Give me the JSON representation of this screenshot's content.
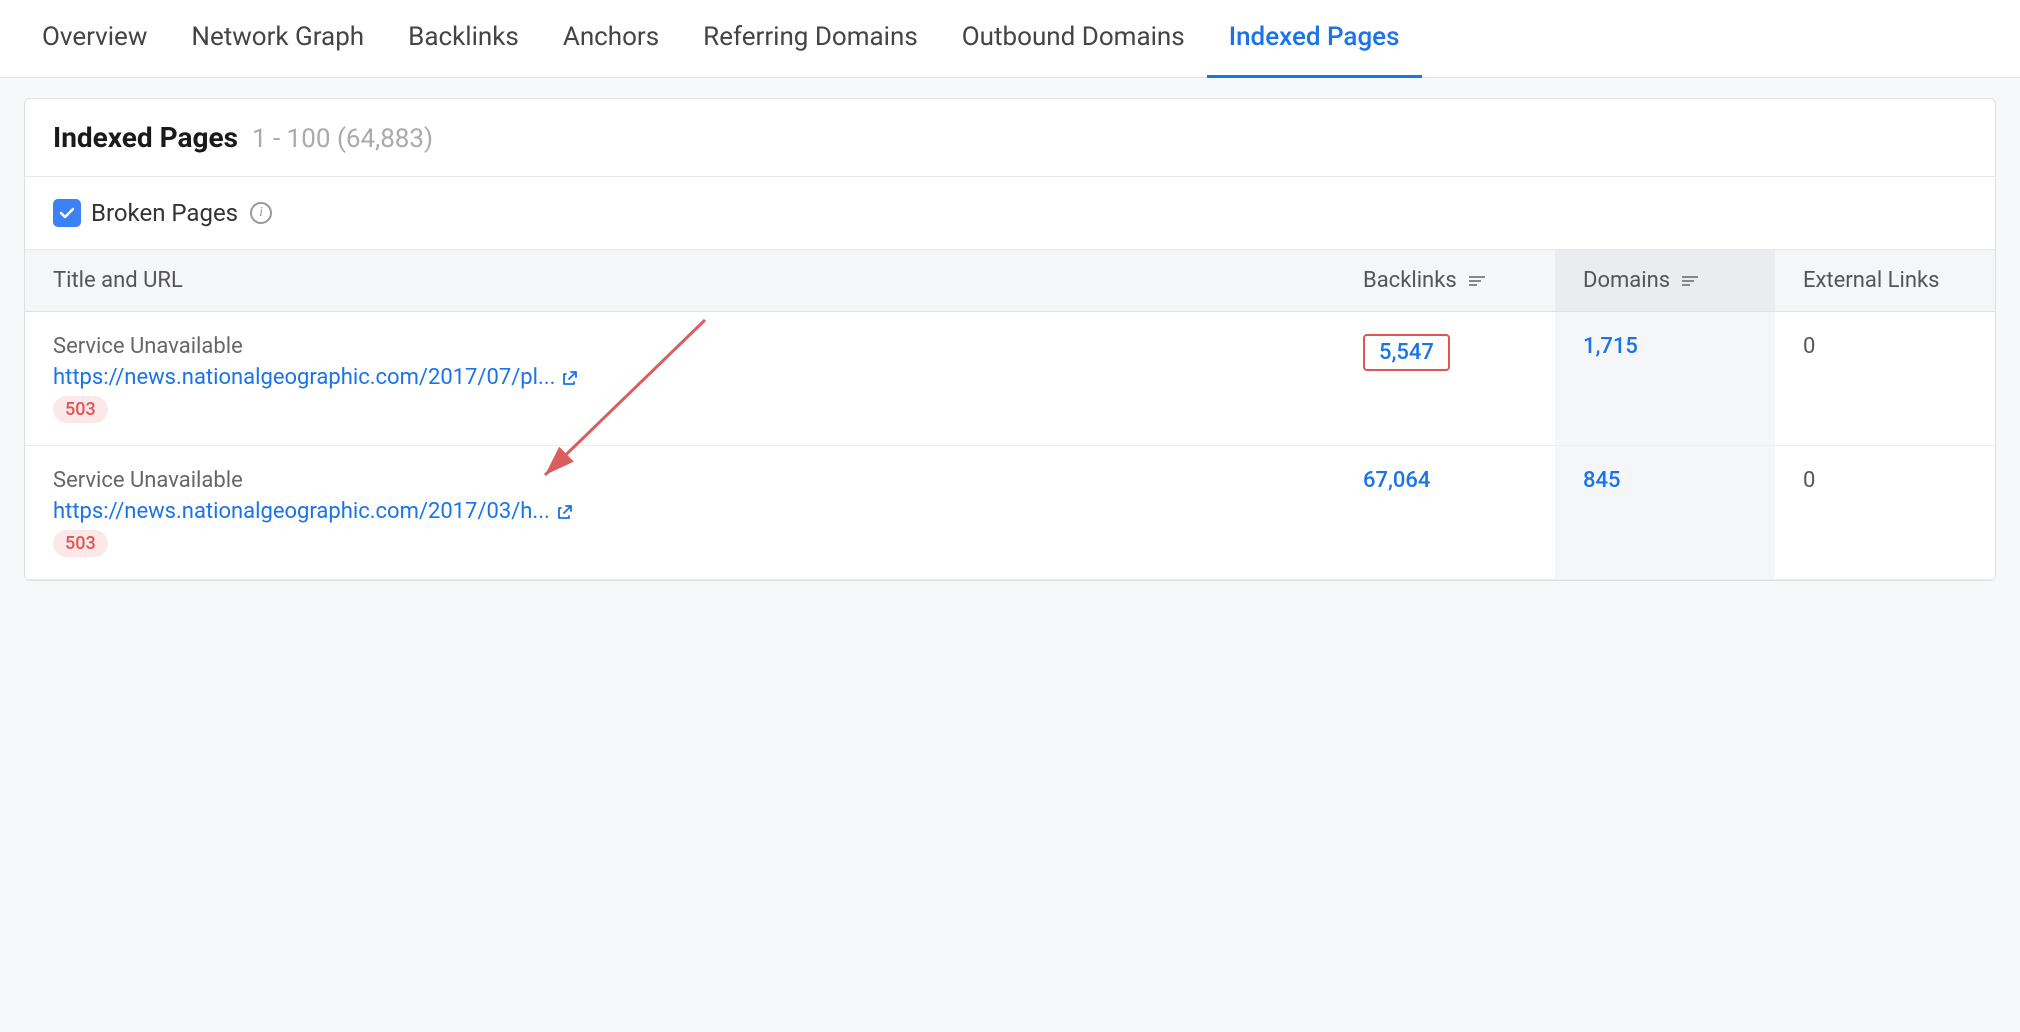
{
  "nav": {
    "items": [
      {
        "id": "overview",
        "label": "Overview",
        "active": false
      },
      {
        "id": "network-graph",
        "label": "Network Graph",
        "active": false
      },
      {
        "id": "backlinks",
        "label": "Backlinks",
        "active": false
      },
      {
        "id": "anchors",
        "label": "Anchors",
        "active": false
      },
      {
        "id": "referring-domains",
        "label": "Referring Domains",
        "active": false
      },
      {
        "id": "outbound-domains",
        "label": "Outbound Domains",
        "active": false
      },
      {
        "id": "indexed-pages",
        "label": "Indexed Pages",
        "active": true
      }
    ]
  },
  "page": {
    "title": "Indexed Pages",
    "subtitle": "1 - 100 (64,883)",
    "filter": {
      "label": "Broken Pages",
      "checked": true,
      "info": "i"
    },
    "table": {
      "columns": [
        {
          "id": "title-url",
          "label": "Title and URL",
          "highlighted": false,
          "sortable": false
        },
        {
          "id": "backlinks",
          "label": "Backlinks",
          "highlighted": false,
          "sortable": true
        },
        {
          "id": "domains",
          "label": "Domains",
          "highlighted": true,
          "sortable": true
        },
        {
          "id": "external-links",
          "label": "External Links",
          "highlighted": false,
          "sortable": false
        }
      ],
      "rows": [
        {
          "title": "Service Unavailable",
          "url": "https://news.nationalgeographic.com/2017/07/pl...",
          "status": "503",
          "backlinks": "5,547",
          "domains": "1,715",
          "external_links": "0",
          "highlight_backlinks": true
        },
        {
          "title": "Service Unavailable",
          "url": "https://news.nationalgeographic.com/2017/03/h...",
          "status": "503",
          "backlinks": "67,064",
          "domains": "845",
          "external_links": "0",
          "highlight_backlinks": false
        }
      ]
    }
  }
}
